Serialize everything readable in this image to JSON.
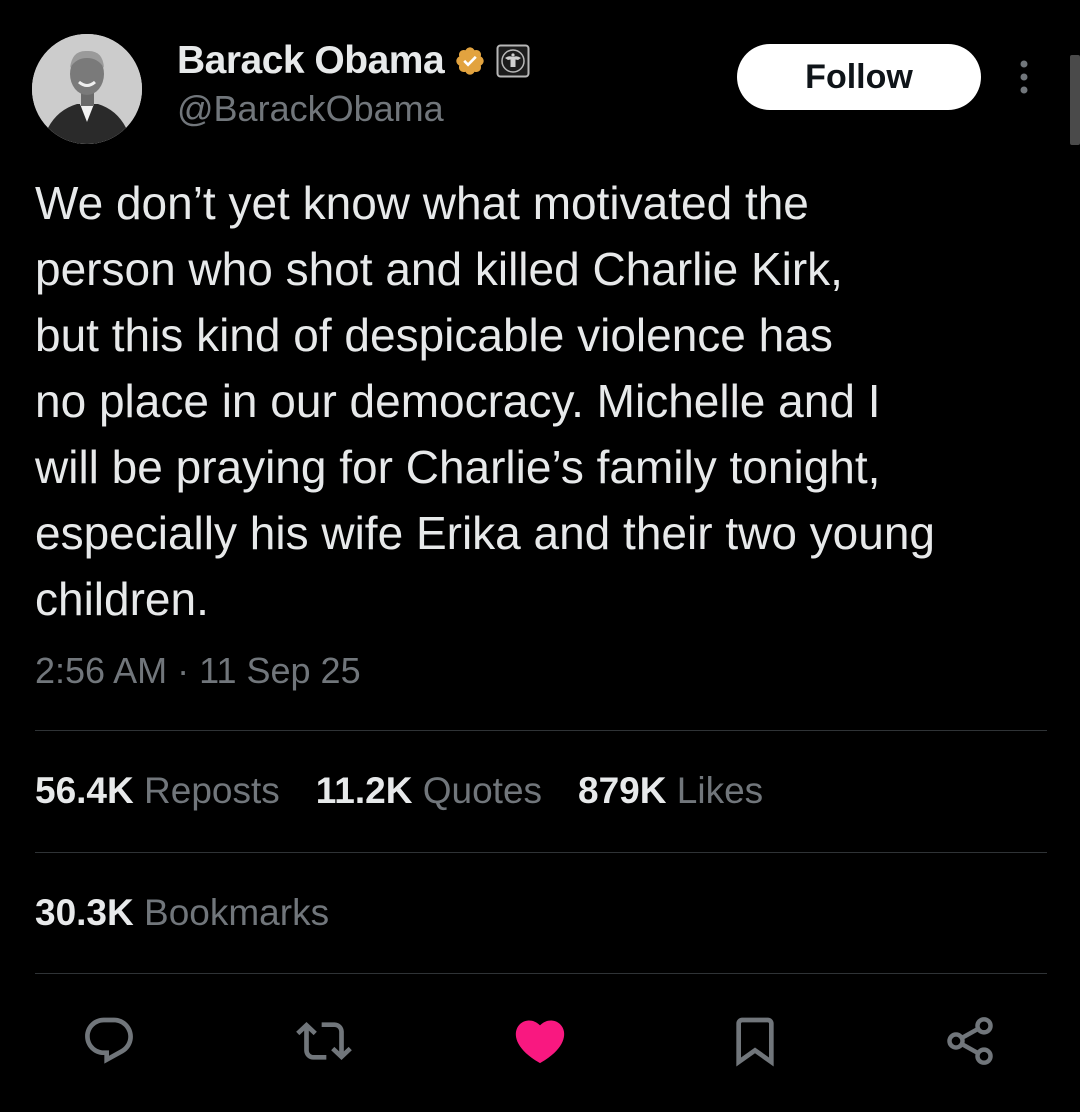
{
  "author": {
    "display_name": "Barack Obama",
    "handle": "@BarackObama",
    "verified_badge_icon": "verified-badge-icon",
    "affiliation_icon": "government-seal-icon"
  },
  "follow_button": {
    "label": "Follow"
  },
  "tweet": {
    "text": "We don’t yet know what motivated the\nperson who shot and killed Charlie Kirk,\nbut this kind of despicable violence has\nno place in our democracy. Michelle and I\nwill be praying for Charlie’s family tonight,\nespecially his wife Erika and their two young\nchildren.",
    "time": "2:56 AM",
    "separator": "·",
    "date": "11 Sep 25"
  },
  "stats": {
    "reposts": {
      "count": "56.4K",
      "label": "Reposts"
    },
    "quotes": {
      "count": "11.2K",
      "label": "Quotes"
    },
    "likes": {
      "count": "879K",
      "label": "Likes"
    },
    "bookmarks": {
      "count": "30.3K",
      "label": "Bookmarks"
    }
  },
  "actions": {
    "reply_icon": "reply-icon",
    "repost_icon": "repost-icon",
    "like_icon": "heart-icon",
    "bookmark_icon": "bookmark-icon",
    "share_icon": "share-icon"
  },
  "colors": {
    "background": "#000000",
    "text_primary": "#e7e9ea",
    "text_secondary": "#71767b",
    "verified_gold": "#e2a33f",
    "liked_pink": "#f91880",
    "divider": "#2f3336"
  }
}
